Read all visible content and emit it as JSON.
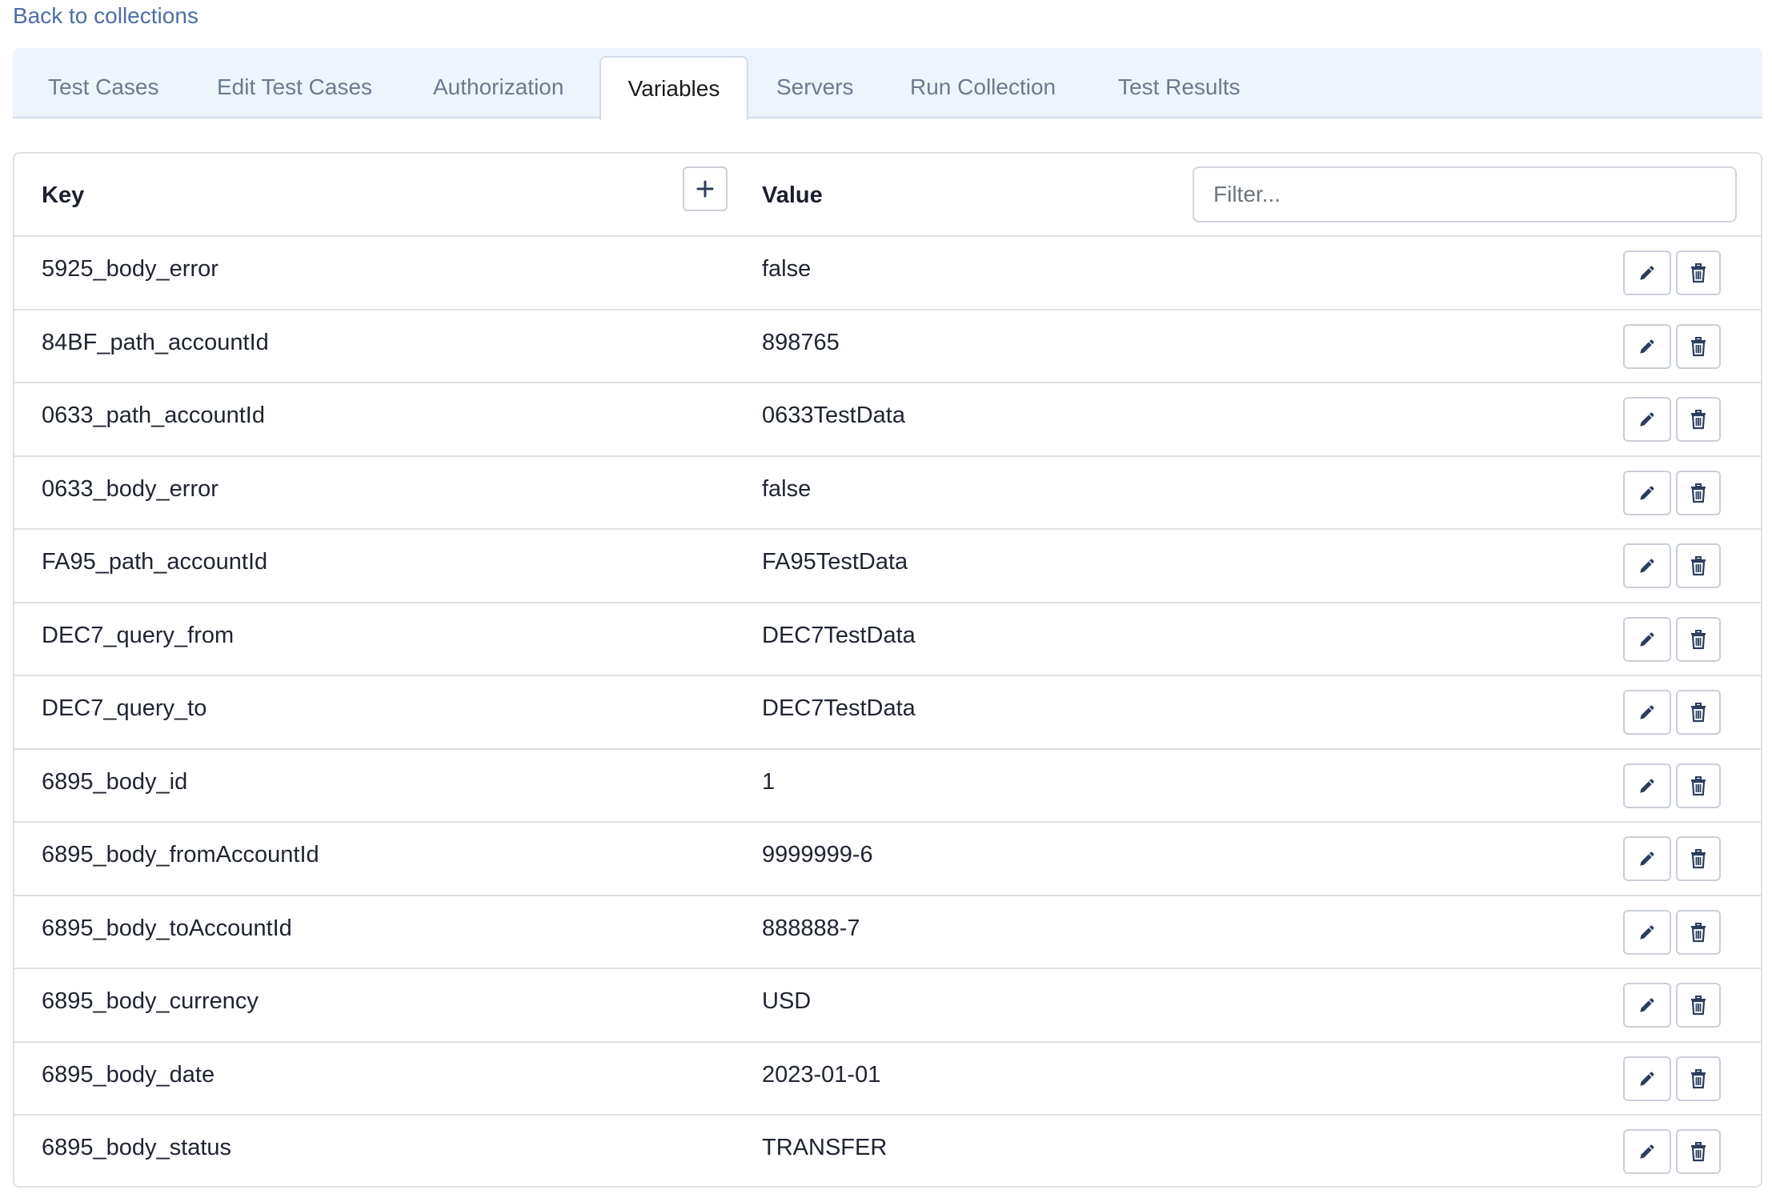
{
  "nav": {
    "back_label": "Back to collections"
  },
  "tabs": [
    {
      "label": "Test Cases",
      "active": false
    },
    {
      "label": "Edit Test Cases",
      "active": false
    },
    {
      "label": "Authorization",
      "active": false
    },
    {
      "label": "Variables",
      "active": true
    },
    {
      "label": "Servers",
      "active": false
    },
    {
      "label": "Run Collection",
      "active": false
    },
    {
      "label": "Test Results",
      "active": false
    }
  ],
  "table": {
    "key_header": "Key",
    "value_header": "Value",
    "add_icon": "plus-icon",
    "filter_placeholder": "Filter...",
    "filter_value": "",
    "row_action_icons": [
      "pencil-icon",
      "trash-icon"
    ],
    "rows": [
      {
        "key": "5925_body_error",
        "value": "false"
      },
      {
        "key": "84BF_path_accountId",
        "value": "898765"
      },
      {
        "key": "0633_path_accountId",
        "value": "0633TestData"
      },
      {
        "key": "0633_body_error",
        "value": "false"
      },
      {
        "key": "FA95_path_accountId",
        "value": "FA95TestData"
      },
      {
        "key": "DEC7_query_from",
        "value": "DEC7TestData"
      },
      {
        "key": "DEC7_query_to",
        "value": "DEC7TestData"
      },
      {
        "key": "6895_body_id",
        "value": "1"
      },
      {
        "key": "6895_body_fromAccountId",
        "value": "9999999-6"
      },
      {
        "key": "6895_body_toAccountId",
        "value": "888888-7"
      },
      {
        "key": "6895_body_currency",
        "value": "USD"
      },
      {
        "key": "6895_body_date",
        "value": "2023-01-01"
      },
      {
        "key": "6895_body_status",
        "value": "TRANSFER"
      }
    ]
  },
  "colors": {
    "link": "#4d6fa3",
    "tab_bar_bg": "#eef4fc",
    "border": "#dcdfe4",
    "icon": "#2c3e5c"
  }
}
